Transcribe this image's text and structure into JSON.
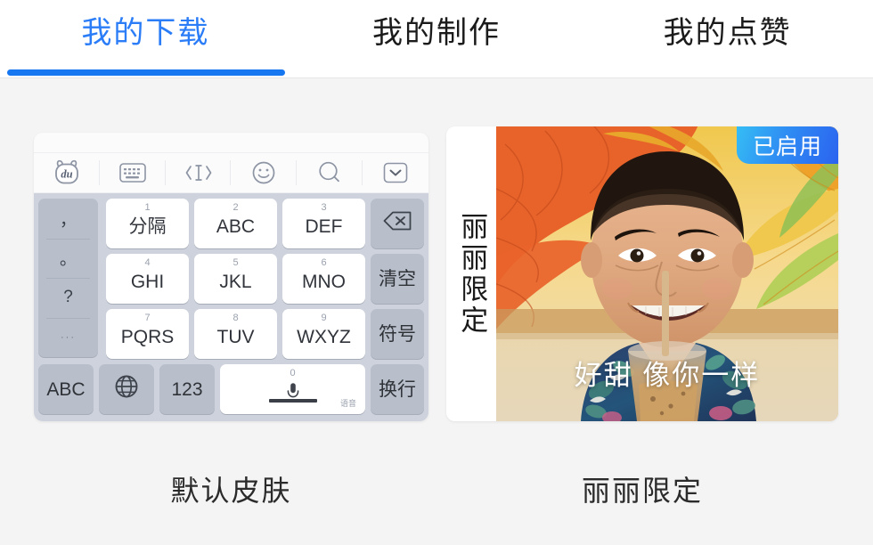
{
  "tabs": [
    {
      "label": "我的下载",
      "active": true
    },
    {
      "label": "我的制作",
      "active": false
    },
    {
      "label": "我的点赞",
      "active": false
    }
  ],
  "colors": {
    "accent": "#1677f0",
    "active_tab_text": "#2a7cf7",
    "page_background": "#f4f4f4",
    "badge_gradient_start": "#35bdf5",
    "badge_gradient_end": "#2b63f0",
    "keyboard_background": "#cdd2dc",
    "key_light": "#ffffff",
    "key_dark": "#b8bfcb"
  },
  "skins": [
    {
      "id": "default-skin",
      "caption": "默认皮肤",
      "enabled": false
    },
    {
      "id": "lili-skin",
      "caption": "丽丽限定",
      "side_text": "丽丽限定",
      "badge": "已启用",
      "video_caption": "好甜 像你一样"
    }
  ],
  "keyboard": {
    "toolbar": [
      {
        "icon": "baidu-bear-logo-icon",
        "label": "du"
      },
      {
        "icon": "keyboard-icon"
      },
      {
        "icon": "cursor-move-icon"
      },
      {
        "icon": "emoji-smiley-icon"
      },
      {
        "icon": "search-icon"
      },
      {
        "icon": "chevron-down-icon"
      }
    ],
    "punctuation_column": [
      {
        "label": "，"
      },
      {
        "label": "。"
      },
      {
        "label": "?"
      },
      {
        "label": "···"
      }
    ],
    "keys": [
      {
        "num": "1",
        "main": "分隔",
        "style": "light"
      },
      {
        "num": "2",
        "main": "ABC",
        "style": "light"
      },
      {
        "num": "3",
        "main": "DEF",
        "style": "light"
      },
      {
        "num": "4",
        "main": "GHI",
        "style": "light"
      },
      {
        "num": "5",
        "main": "JKL",
        "style": "light"
      },
      {
        "num": "6",
        "main": "MNO",
        "style": "light"
      },
      {
        "num": "7",
        "main": "PQRS",
        "style": "light"
      },
      {
        "num": "8",
        "main": "TUV",
        "style": "light"
      },
      {
        "num": "9",
        "main": "WXYZ",
        "style": "light"
      }
    ],
    "right_column": [
      {
        "icon": "backspace-icon",
        "main": "",
        "style": "dark"
      },
      {
        "main": "清空",
        "style": "dark"
      },
      {
        "main": "符号",
        "style": "dark"
      },
      {
        "main": "换行",
        "style": "dark"
      }
    ],
    "bottom_row": [
      {
        "main": "ABC",
        "style": "dark"
      },
      {
        "icon": "globe-icon",
        "main": "",
        "style": "dark"
      },
      {
        "main": "123",
        "style": "dark"
      }
    ],
    "space_key": {
      "num": "0",
      "icon": "microphone-icon",
      "voice_label": "语音"
    }
  }
}
